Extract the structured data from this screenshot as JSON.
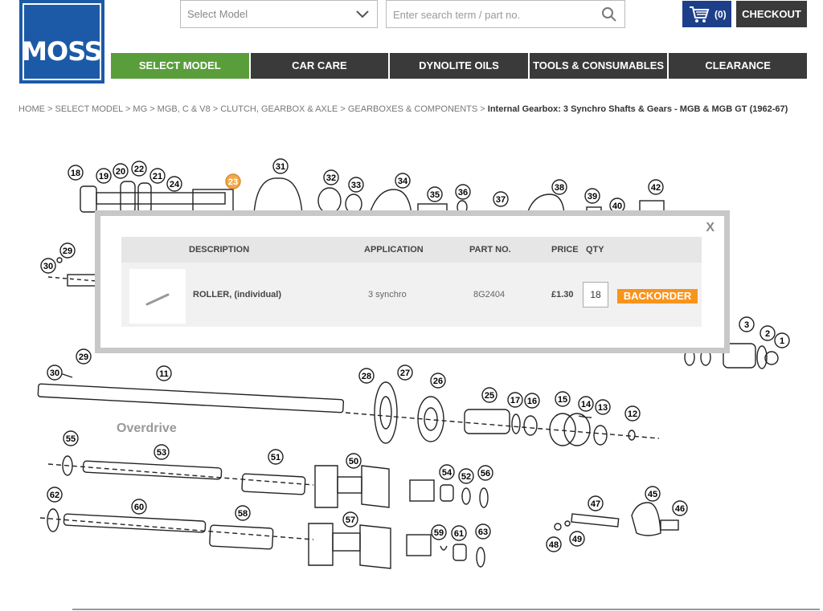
{
  "header": {
    "logo_text": "MOSS",
    "select_model_text": "Select Model",
    "search_placeholder": "Enter search term / part no.",
    "cart_count": "(0)",
    "checkout_label": "CHECKOUT"
  },
  "nav": [
    {
      "label": "SELECT MODEL",
      "active": true
    },
    {
      "label": "CAR CARE"
    },
    {
      "label": "DYNOLITE OILS"
    },
    {
      "label": "TOOLS & CONSUMABLES"
    },
    {
      "label": "CLEARANCE"
    }
  ],
  "breadcrumb": {
    "path": "HOME > SELECT MODEL > MG > MGB, C & V8 > CLUTCH, GEARBOX & AXLE > GEARBOXES & COMPONENTS > ",
    "current": "Internal Gearbox: 3 Synchro Shafts & Gears - MGB & MGB GT (1962-67)"
  },
  "diagram": {
    "label_overdrive": "Overdrive",
    "callouts": [
      "18",
      "19",
      "20",
      "22",
      "21",
      "24",
      "23",
      "31",
      "32",
      "33",
      "34",
      "35",
      "36",
      "37",
      "38",
      "39",
      "40",
      "42",
      "29",
      "30",
      "3",
      "2",
      "1",
      "29",
      "30",
      "11",
      "28",
      "27",
      "26",
      "25",
      "17",
      "16",
      "15",
      "14",
      "13",
      "12",
      "55",
      "53",
      "51",
      "50",
      "54",
      "52",
      "56",
      "62",
      "60",
      "58",
      "57",
      "59",
      "61",
      "63",
      "47",
      "45",
      "46",
      "48",
      "49"
    ],
    "highlight_callout": "23"
  },
  "modal": {
    "close_label": "X",
    "headers": {
      "description": "DESCRIPTION",
      "application": "APPLICATION",
      "part_no": "PART NO.",
      "price": "PRICE",
      "qty": "QTY"
    },
    "item": {
      "description": "ROLLER, (individual)",
      "application": "3 synchro",
      "part_no": "8G2404",
      "price": "£1.30",
      "qty": "18",
      "action_label": "BACKORDER"
    }
  },
  "colors": {
    "brand_blue": "#1c5aa8",
    "nav_dark": "#3a3a3a",
    "nav_active": "#5a9e3c",
    "backorder": "#f7941d",
    "cart_blue": "#1d3f8a",
    "highlight": "#f4a94a"
  }
}
